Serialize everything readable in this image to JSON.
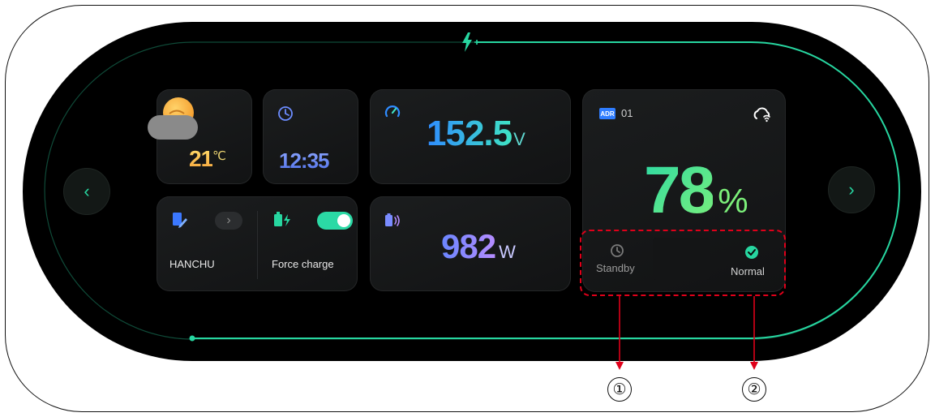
{
  "weather": {
    "temperature": "21",
    "unit": "℃",
    "icon": "partly-cloudy-icon"
  },
  "clock": {
    "time": "12:35",
    "icon": "clock-icon"
  },
  "voltage": {
    "value": "152.5",
    "unit": "V",
    "icon": "speedometer-icon"
  },
  "power": {
    "value": "982",
    "unit": "W",
    "icon": "battery-signal-icon"
  },
  "brand_card": {
    "label": "HANCHU",
    "icon": "edit-device-icon",
    "arrow": "›"
  },
  "force_charge": {
    "label": "Force charge",
    "enabled": true,
    "icon": "battery-charging-icon"
  },
  "battery": {
    "badge": "ADR",
    "id": "01",
    "percent": "78",
    "percent_sign": "%",
    "icon": "cloud-wifi-icon",
    "modes": [
      {
        "label": "Standby",
        "icon": "clock-icon",
        "active": false
      },
      {
        "label": "Normal",
        "icon": "check-circle-icon",
        "active": true
      }
    ]
  },
  "nav": {
    "prev": "‹",
    "next": "›"
  },
  "callouts": [
    "①",
    "②"
  ],
  "colors": {
    "accent": "#27d6a0",
    "voltage_gradient": [
      "#2f8cff",
      "#3fe3c4"
    ],
    "power_gradient": [
      "#6a86ff",
      "#b58cff"
    ],
    "percent_gradient": [
      "#2bd9a5",
      "#7cf07a"
    ],
    "temp_gradient": [
      "#ffe070",
      "#f6a43a"
    ],
    "time_gradient": [
      "#8fa8ff",
      "#4d6fe8"
    ],
    "callout_outline": "#e0001a"
  }
}
